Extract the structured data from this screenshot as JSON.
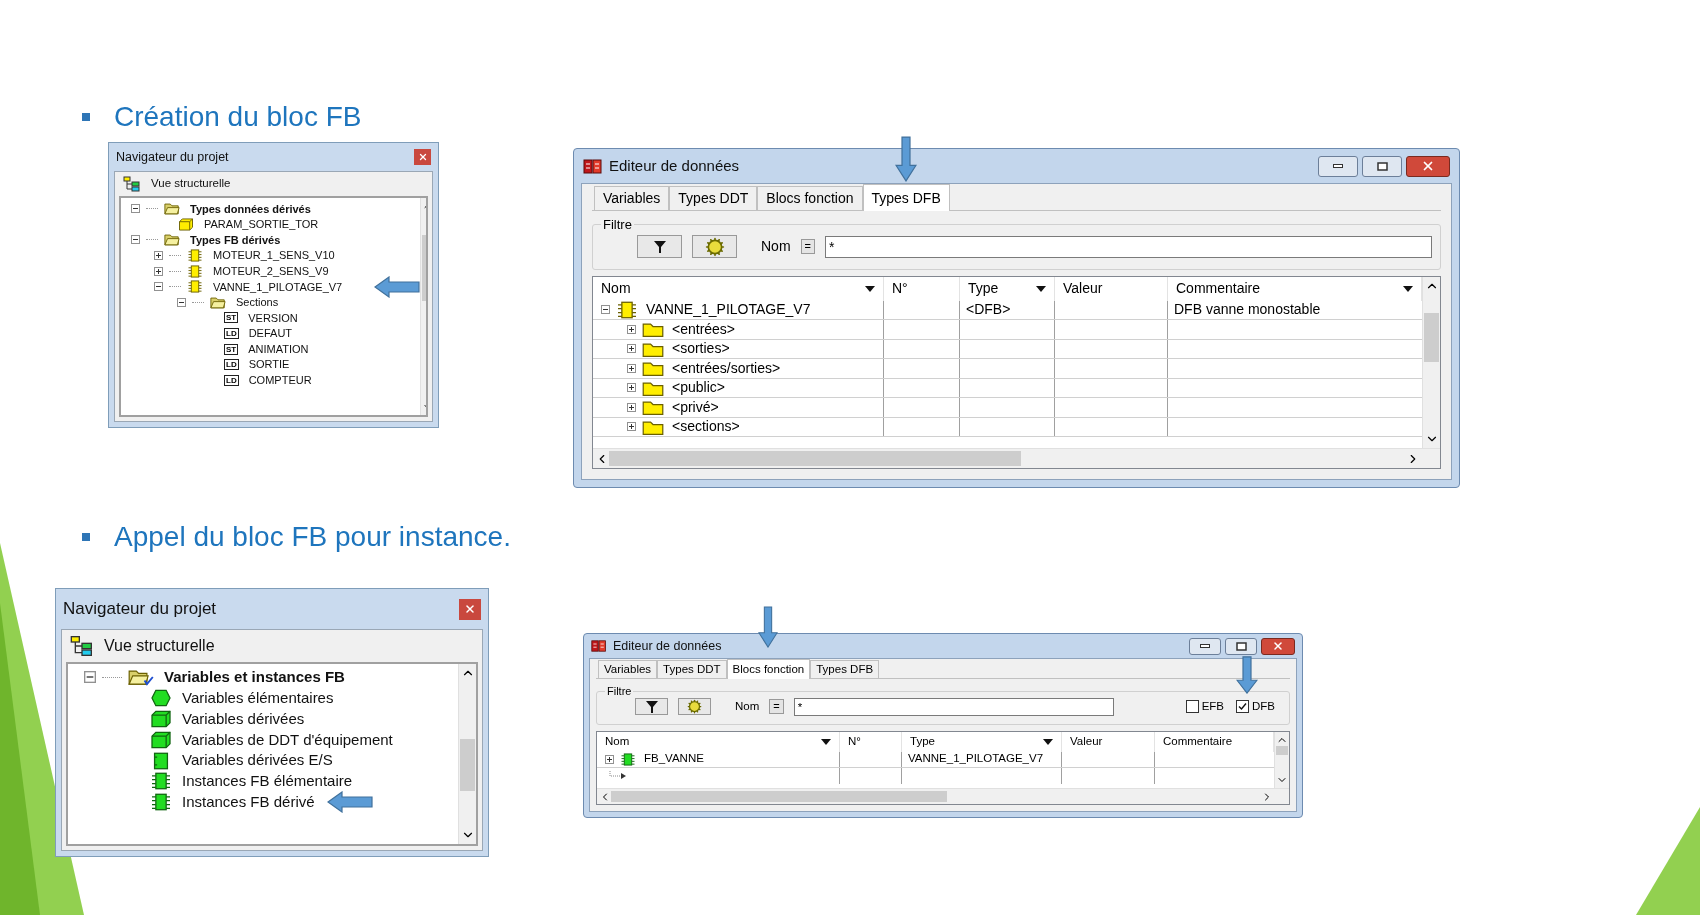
{
  "slide": {
    "sections": [
      {
        "heading": "Création du bloc FB",
        "navigator": {
          "title": "Navigateur du projet",
          "view_label": "Vue structurelle",
          "tree": [
            {
              "label": "Types données dérivés",
              "bold": true,
              "kind": "openfolder",
              "expanded": true,
              "children": [
                {
                  "label": "PARAM_SORTIE_TOR",
                  "bold": false,
                  "kind": "struct"
                }
              ]
            },
            {
              "label": "Types FB dérivés",
              "bold": true,
              "kind": "openfolder",
              "expanded": true,
              "children": [
                {
                  "label": "MOTEUR_1_SENS_V10",
                  "bold": false,
                  "kind": "dfb",
                  "expanded": false
                },
                {
                  "label": "MOTEUR_2_SENS_V9",
                  "bold": false,
                  "kind": "dfb",
                  "expanded": false
                },
                {
                  "label": "VANNE_1_PILOTAGE_V7",
                  "bold": false,
                  "kind": "dfb",
                  "expanded": true,
                  "pointed": true,
                  "children": [
                    {
                      "label": "Sections",
                      "bold": false,
                      "kind": "openfolder",
                      "expanded": true,
                      "children": [
                        {
                          "label": "VERSION",
                          "bold": false,
                          "kind": "section",
                          "language": "ST"
                        },
                        {
                          "label": "DEFAUT",
                          "bold": false,
                          "kind": "section",
                          "language": "LD"
                        },
                        {
                          "label": "ANIMATION",
                          "bold": false,
                          "kind": "section",
                          "language": "ST"
                        },
                        {
                          "label": "SORTIE",
                          "bold": false,
                          "kind": "section",
                          "language": "LD"
                        },
                        {
                          "label": "COMPTEUR",
                          "bold": false,
                          "kind": "section",
                          "language": "LD"
                        }
                      ]
                    }
                  ]
                }
              ]
            }
          ]
        },
        "editor": {
          "title": "Editeur de données",
          "tabs": [
            {
              "label": "Variables",
              "selected": false
            },
            {
              "label": "Types DDT",
              "selected": false
            },
            {
              "label": "Blocs fonction",
              "selected": false
            },
            {
              "label": "Types DFB",
              "selected": true,
              "pointed": true
            }
          ],
          "filter": {
            "label": "Filtre",
            "name_label": "Nom",
            "operator": "=",
            "value": "*"
          },
          "columns": [
            {
              "label": "Nom",
              "dropdown": true
            },
            {
              "label": "N°",
              "dropdown": false
            },
            {
              "label": "Type",
              "dropdown": true
            },
            {
              "label": "Valeur",
              "dropdown": false
            },
            {
              "label": "Commentaire",
              "dropdown": true
            }
          ],
          "rows": [
            {
              "kind": "dfb",
              "name": "VANNE_1_PILOTAGE_V7",
              "expanded": true,
              "type": "<DFB>",
              "comment": "DFB vanne monostable",
              "children": [
                {
                  "kind": "folder",
                  "name": "<entrées>",
                  "expanded": false
                },
                {
                  "kind": "folder",
                  "name": "<sorties>",
                  "expanded": false
                },
                {
                  "kind": "folder",
                  "name": "<entrées/sorties>",
                  "expanded": false
                },
                {
                  "kind": "folder",
                  "name": "<public>",
                  "expanded": false
                },
                {
                  "kind": "folder",
                  "name": "<privé>",
                  "expanded": false
                },
                {
                  "kind": "folder",
                  "name": "<sections>",
                  "expanded": false
                }
              ]
            }
          ]
        }
      },
      {
        "heading": "Appel du bloc FB pour instance.",
        "navigator": {
          "title": "Navigateur du projet",
          "view_label": "Vue structurelle",
          "tree": [
            {
              "label": "Variables et instances FB",
              "bold": true,
              "kind": "checkfolder",
              "expanded": true,
              "children": [
                {
                  "label": "Variables élémentaires",
                  "bold": false,
                  "kind": "ball"
                },
                {
                  "label": "Variables dérivées",
                  "bold": false,
                  "kind": "greenstruct"
                },
                {
                  "label": "Variables de DDT d'équipement",
                  "bold": false,
                  "kind": "greenstruct"
                },
                {
                  "label": "Variables dérivées E/S",
                  "bold": false,
                  "kind": "io"
                },
                {
                  "label": "Instances FB élémentaire",
                  "bold": false,
                  "kind": "greenchip"
                },
                {
                  "label": "Instances FB dérivé",
                  "bold": false,
                  "kind": "greenchip",
                  "pointed": true
                }
              ]
            }
          ]
        },
        "editor": {
          "title": "Editeur de données",
          "tabs": [
            {
              "label": "Variables",
              "selected": false
            },
            {
              "label": "Types DDT",
              "selected": false
            },
            {
              "label": "Blocs fonction",
              "selected": true,
              "pointed": true
            },
            {
              "label": "Types DFB",
              "selected": false
            }
          ],
          "filter": {
            "label": "Filtre",
            "name_label": "Nom",
            "operator": "=",
            "value": "*",
            "checkboxes": [
              {
                "label": "EFB",
                "checked": false
              },
              {
                "label": "DFB",
                "checked": true,
                "pointed": true
              }
            ]
          },
          "columns": [
            {
              "label": "Nom",
              "dropdown": true
            },
            {
              "label": "N°",
              "dropdown": false
            },
            {
              "label": "Type",
              "dropdown": true
            },
            {
              "label": "Valeur",
              "dropdown": false
            },
            {
              "label": "Commentaire",
              "dropdown": false
            }
          ],
          "rows": [
            {
              "kind": "greenchip",
              "name": "FB_VANNE",
              "expanded": false,
              "type": "VANNE_1_PILOTAGE_V7"
            },
            {
              "kind": "new"
            }
          ]
        }
      }
    ]
  }
}
